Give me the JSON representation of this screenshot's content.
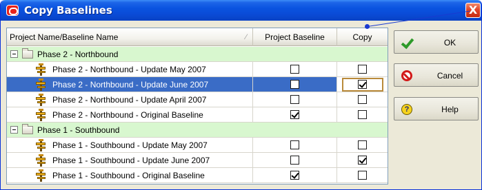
{
  "window": {
    "title": "Copy Baselines",
    "close_glyph": "X"
  },
  "grid": {
    "columns": [
      "Project Name/Baseline Name",
      "Project Baseline",
      "Copy"
    ],
    "sort_glyph": "⁄",
    "groups": [
      {
        "name": "Phase 2 - Northbound",
        "rows": [
          {
            "name": "Phase 2 - Northbound - Update May 2007",
            "project_baseline": false,
            "copy": false,
            "selected": false
          },
          {
            "name": "Phase 2 - Northbound - Update June 2007",
            "project_baseline": false,
            "copy": true,
            "selected": true
          },
          {
            "name": "Phase 2 - Northbound - Update April 2007",
            "project_baseline": false,
            "copy": false,
            "selected": false
          },
          {
            "name": "Phase 2 - Northbound - Original Baseline",
            "project_baseline": true,
            "copy": false,
            "selected": false
          }
        ]
      },
      {
        "name": "Phase 1 - Southbound",
        "rows": [
          {
            "name": "Phase 1 - Southbound - Update May 2007",
            "project_baseline": false,
            "copy": false,
            "selected": false
          },
          {
            "name": "Phase 1 - Southbound - Update June 2007",
            "project_baseline": false,
            "copy": true,
            "selected": false
          },
          {
            "name": "Phase 1 - Southbound - Original Baseline",
            "project_baseline": true,
            "copy": false,
            "selected": false
          }
        ]
      }
    ]
  },
  "buttons": {
    "ok": {
      "label": "OK",
      "icon": "checkmark-icon"
    },
    "cancel": {
      "label": "Cancel",
      "icon": "cancel-icon"
    },
    "help": {
      "label": "Help",
      "icon": "help-icon"
    }
  },
  "colors": {
    "group_row": "#d8f7cf",
    "selected_row": "#3a6cc6",
    "titlebar": "#0a54e0"
  }
}
